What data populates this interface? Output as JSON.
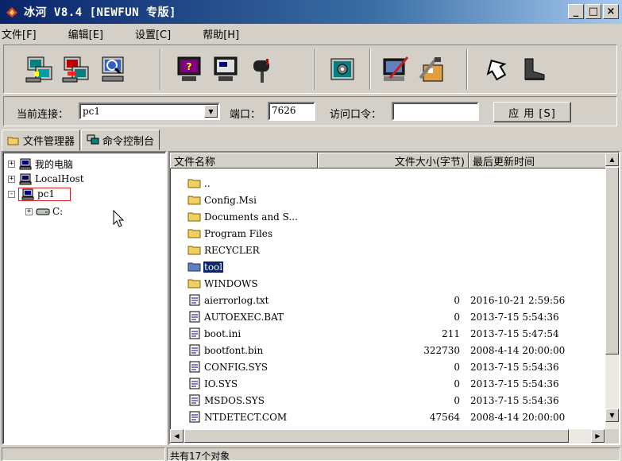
{
  "window": {
    "title": "冰河 V8.4 [NEWFUN 专版]",
    "minimize": "_",
    "maximize": "□",
    "close": "×"
  },
  "menu": [
    "文件[F]",
    "编辑[E]",
    "设置[C]",
    "帮助[H]"
  ],
  "toolbar": {
    "groups": [
      [
        "add-computer-icon",
        "remove-computer-icon",
        "search-computer-icon"
      ],
      [
        "screen-capture-icon",
        "screen-control-icon",
        "mailbox-icon"
      ],
      [
        "settings-panel-icon"
      ],
      [
        "config-server-icon",
        "packaging-tools-icon"
      ],
      [
        "back-icon",
        "exit-boot-icon"
      ]
    ]
  },
  "connection": {
    "current_label": "当前连接：",
    "current_value": "pc1",
    "port_label": "端口：",
    "port_value": "7626",
    "password_label": "访问口令：",
    "password_value": "",
    "apply_label": "应 用 [S]"
  },
  "tabs": [
    "文件管理器",
    "命令控制台"
  ],
  "tree": [
    {
      "label": "我的电脑",
      "expander": "+",
      "icon": "computer-icon"
    },
    {
      "label": "LocalHost",
      "expander": "+",
      "icon": "computer-icon"
    },
    {
      "label": "pc1",
      "expander": "-",
      "icon": "computer-icon"
    },
    {
      "label": "C:",
      "expander": "+",
      "icon": "drive-icon"
    }
  ],
  "list": {
    "columns": [
      "文件名称",
      "文件大小(字节)",
      "最后更新时间"
    ],
    "rows": [
      {
        "name": "..",
        "type": "folder",
        "size": "",
        "time": ""
      },
      {
        "name": "Config.Msi",
        "type": "folder",
        "size": "",
        "time": ""
      },
      {
        "name": "Documents and S...",
        "type": "folder",
        "size": "",
        "time": ""
      },
      {
        "name": "Program Files",
        "type": "folder",
        "size": "",
        "time": ""
      },
      {
        "name": "RECYCLER",
        "type": "folder",
        "size": "",
        "time": ""
      },
      {
        "name": "tool",
        "type": "folder-selected",
        "size": "",
        "time": ""
      },
      {
        "name": "WINDOWS",
        "type": "folder",
        "size": "",
        "time": ""
      },
      {
        "name": "aierrorlog.txt",
        "type": "file",
        "size": "0",
        "time": "2016-10-21 2:59:56"
      },
      {
        "name": "AUTOEXEC.BAT",
        "type": "file",
        "size": "0",
        "time": "2013-7-15 5:54:36"
      },
      {
        "name": "boot.ini",
        "type": "file",
        "size": "211",
        "time": "2013-7-15 5:47:54"
      },
      {
        "name": "bootfont.bin",
        "type": "file",
        "size": "322730",
        "time": "2008-4-14 20:00:00"
      },
      {
        "name": "CONFIG.SYS",
        "type": "file",
        "size": "0",
        "time": "2013-7-15 5:54:36"
      },
      {
        "name": "IO.SYS",
        "type": "file",
        "size": "0",
        "time": "2013-7-15 5:54:36"
      },
      {
        "name": "MSDOS.SYS",
        "type": "file",
        "size": "0",
        "time": "2013-7-15 5:54:36"
      },
      {
        "name": "NTDETECT.COM",
        "type": "file",
        "size": "47564",
        "time": "2008-4-14 20:00:00"
      }
    ]
  },
  "status": {
    "left": "",
    "right": "共有17个对象"
  },
  "colors": {
    "titlebar_start": "#0a246a",
    "titlebar_end": "#a6caf0",
    "selection": "#0a246a",
    "folder": "#f0d060",
    "face": "#d4d0c8",
    "highlight_box": "#d02020"
  }
}
